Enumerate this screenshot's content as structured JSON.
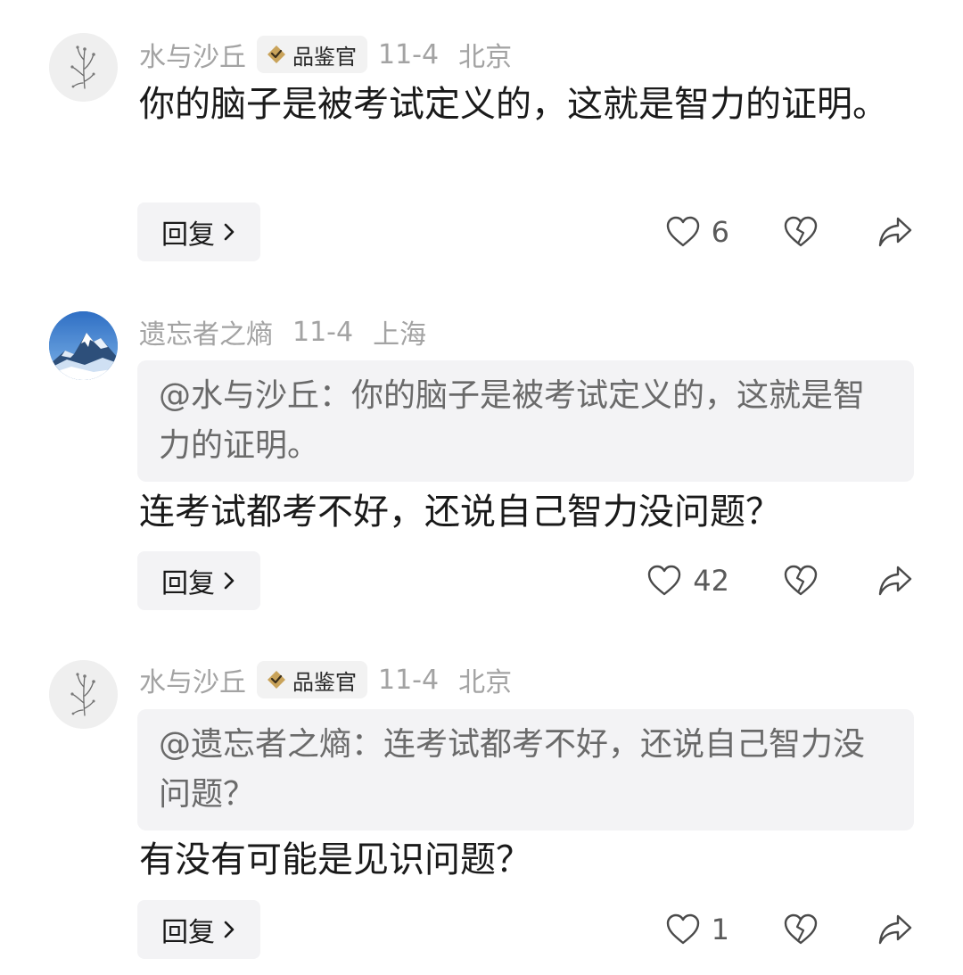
{
  "comments": [
    {
      "author": "水与沙丘",
      "badge": "品鉴官",
      "date": "11-4",
      "location": "北京",
      "quote": "",
      "body": "你的脑子是被考试定义的，这就是智力的证明。",
      "reply_label": "回复",
      "likes": "6",
      "avatar": "plant-sketch-avatar"
    },
    {
      "author": "遗忘者之熵",
      "badge": "",
      "date": "11-4",
      "location": "上海",
      "quote": "@水与沙丘：你的脑子是被考试定义的，这就是智力的证明。",
      "body": "连考试都考不好，还说自己智力没问题？",
      "reply_label": "回复",
      "likes": "42",
      "avatar": "snow-mountain-avatar"
    },
    {
      "author": "水与沙丘",
      "badge": "品鉴官",
      "date": "11-4",
      "location": "北京",
      "quote": "@遗忘者之熵：连考试都考不好，还说自己智力没问题？",
      "body": "有没有可能是见识问题？",
      "reply_label": "回复",
      "likes": "1",
      "avatar": "plant-sketch-avatar"
    }
  ],
  "icons": {
    "like": "heart-outline-icon",
    "dislike": "broken-heart-icon",
    "share": "share-arrow-icon",
    "badge": "gold-diamond-badge-icon",
    "reply_chevron": "chevron-right-icon"
  },
  "colors": {
    "meta_text": "#a3a3a3",
    "body_text": "#1a1a1a",
    "quote_bg": "#f3f3f5",
    "badge_gold": "#c9a35a"
  }
}
